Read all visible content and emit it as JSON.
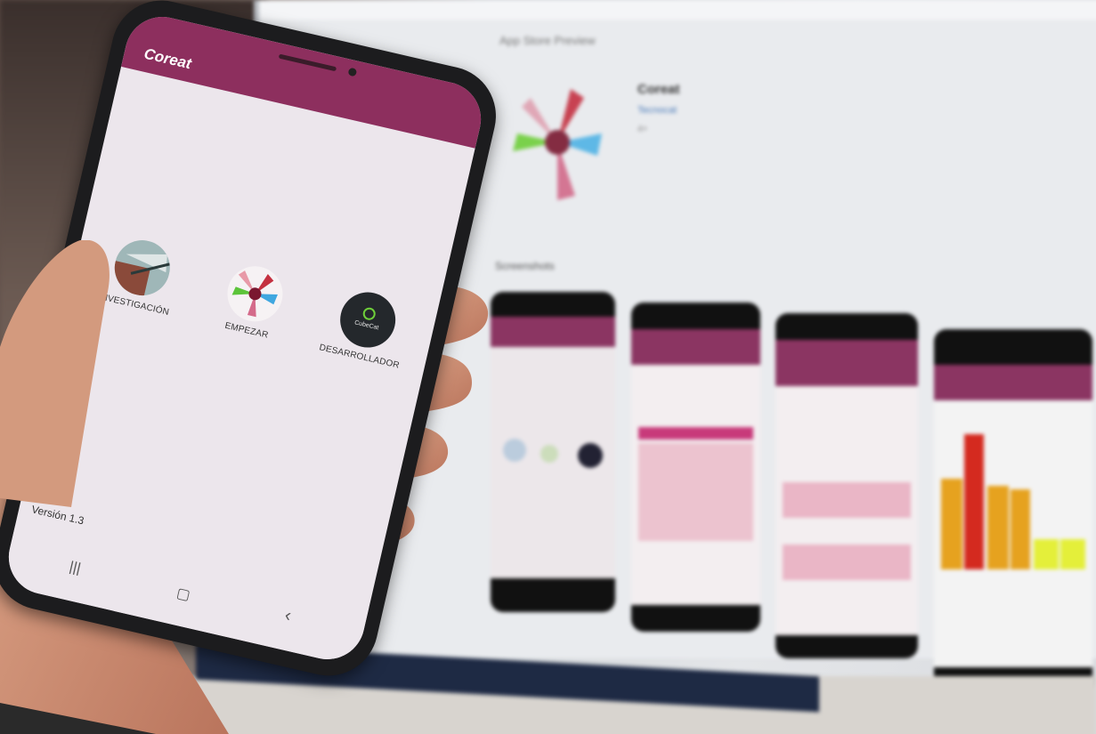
{
  "app": {
    "title": "Coreat",
    "version_label": "Versión 1.3"
  },
  "menu": {
    "items": [
      {
        "label": "INVESTIGACIÓN",
        "icon": "research-photo-icon"
      },
      {
        "label": "EMPEZAR",
        "icon": "colorful-hands-icon"
      },
      {
        "label": "DESARROLLADOR",
        "icon": "cubecat-logo-icon",
        "logo_text": "CubeCat"
      }
    ]
  },
  "navbar": {
    "recent": "|||",
    "home": "▢",
    "back": "‹"
  },
  "monitor": {
    "store_title": "App Store Preview",
    "app_name": "Coreat",
    "app_sub": "Tecnocat",
    "app_age": "4+",
    "shots_label": "Screenshots"
  },
  "colors": {
    "appbar": "#8d2f5e",
    "screen_bg": "#ece6ec",
    "phone_frame": "#1c1c1e"
  }
}
